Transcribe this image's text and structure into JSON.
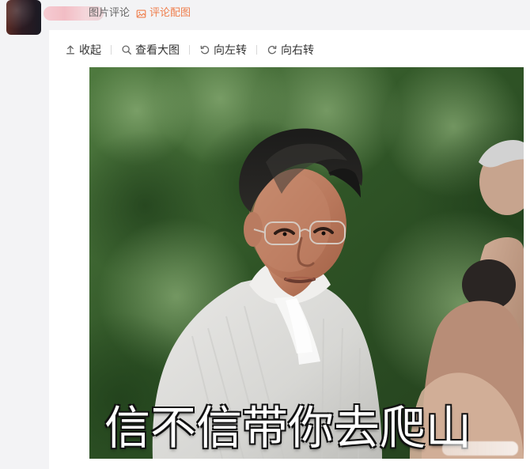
{
  "header": {
    "source_label": "图片评论",
    "comment_image_link": "评论配图"
  },
  "toolbar": {
    "collapse": "收起",
    "view_large": "查看大图",
    "rotate_left": "向左转",
    "rotate_right": "向右转"
  },
  "image": {
    "caption": "信不信带你去爬山"
  },
  "colors": {
    "accent": "#ef7e4c",
    "text": "#333333",
    "muted": "#666666",
    "background": "#f3f3f5"
  },
  "icons": {
    "comment_image_icon": "image-icon",
    "collapse_icon": "arrow-up-icon",
    "view_large_icon": "search-icon",
    "rotate_left_icon": "rotate-left-icon",
    "rotate_right_icon": "rotate-right-icon"
  }
}
